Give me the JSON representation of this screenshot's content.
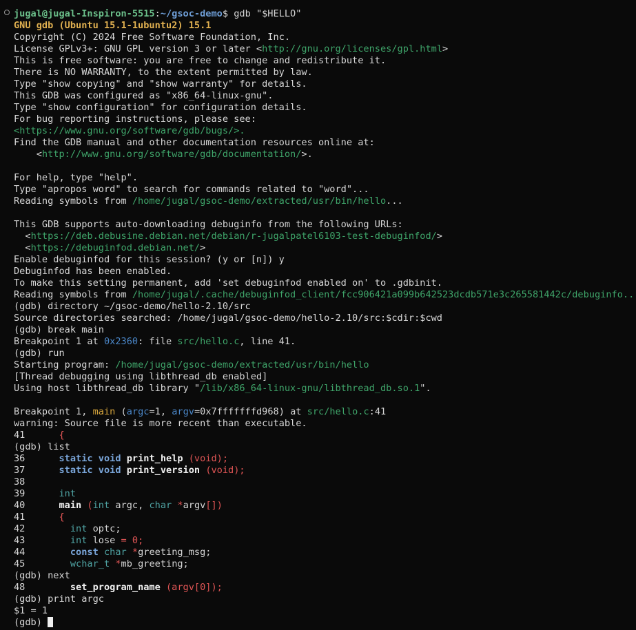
{
  "terminal": {
    "prompt_user": "jugal@jugal-Inspiron-5515",
    "prompt_sep": ":",
    "prompt_path": "~/gsoc-demo",
    "prompt_dollar": "$ ",
    "command": "gdb \"$HELLO\"",
    "gdb_version": "GNU gdb (Ubuntu 15.1-1ubuntu2) 15.1",
    "copyright": "Copyright (C) 2024 Free Software Foundation, Inc.",
    "license_pre": "License GPLv3+: GNU GPL version 3 or later <",
    "license_url": "http://gnu.org/licenses/gpl.html",
    "license_post": ">",
    "free_sw": "This is free software: you are free to change and redistribute it.",
    "no_warranty": "There is NO WARRANTY, to the extent permitted by law.",
    "show_copying": "Type \"show copying\" and \"show warranty\" for details.",
    "configured": "This GDB was configured as \"x86_64-linux-gnu\".",
    "show_config": "Type \"show configuration\" for configuration details.",
    "bug_report": "For bug reporting instructions, please see:",
    "bug_url_pre": "<",
    "bug_url": "https://www.gnu.org/software/gdb/bugs/",
    "bug_url_post": ">.",
    "find_manual": "Find the GDB manual and other documentation resources online at:",
    "doc_url_pre": "    <",
    "doc_url": "http://www.gnu.org/software/gdb/documentation/",
    "doc_url_post": ">.",
    "help": "For help, type \"help\".",
    "apropos": "Type \"apropos word\" to search for commands related to \"word\"...",
    "reading_symbols_pre": "Reading symbols from ",
    "reading_symbols_path": "/home/jugal/gsoc-demo/extracted/usr/bin/hello",
    "reading_symbols_post": "...",
    "debuginfo_supports": "This GDB supports auto-downloading debuginfo from the following URLs:",
    "dbg_url1_pre": "  <",
    "dbg_url1": "https://deb.debusine.debian.net/debian/r-jugalpatel6103-test-debuginfod/",
    "dbg_url1_post": ">",
    "dbg_url2_pre": "  <",
    "dbg_url2": "https://debuginfod.debian.net/",
    "dbg_url2_post": ">",
    "enable_q": "Enable debuginfod for this session? (y or [n]) y",
    "enabled": "Debuginfod has been enabled.",
    "permanent": "To make this setting permanent, add 'set debuginfod enabled on' to .gdbinit.",
    "reading2_pre": "Reading symbols from ",
    "reading2_path": "/home/jugal/.cache/debuginfod_client/fcc906421a099b642523dcdb571e3c265581442c/debuginfo...",
    "cmd_directory": "(gdb) directory ~/gsoc-demo/hello-2.10/src",
    "source_dirs": "Source directories searched: /home/jugal/gsoc-demo/hello-2.10/src:$cdir:$cwd",
    "cmd_break": "(gdb) break main",
    "bp_pre": "Breakpoint 1 at ",
    "bp_addr": "0x2360",
    "bp_mid": ": file ",
    "bp_file": "src/hello.c",
    "bp_post": ", line 41.",
    "cmd_run": "(gdb) run",
    "starting_pre": "Starting program: ",
    "starting_path": "/home/jugal/gsoc-demo/extracted/usr/bin/hello",
    "thread_dbg": "[Thread debugging using libthread_db enabled]",
    "host_lib_pre": "Using host libthread_db library \"",
    "host_lib_path": "/lib/x86_64-linux-gnu/libthread_db.so.1",
    "host_lib_post": "\".",
    "hit_pre": "Breakpoint 1, ",
    "hit_fn": "main",
    "hit_open": " (",
    "hit_argc": "argc",
    "hit_argc_val": "=1, ",
    "hit_argv": "argv",
    "hit_argv_val": "=0x7fffffffd968) at ",
    "hit_file": "src/hello.c",
    "hit_line": ":41",
    "warning": "warning: Source file is more recent than executable.",
    "l41a_num": "41",
    "l41a_code": "{",
    "cmd_list": "(gdb) list",
    "l36_num": "36",
    "l36_kw1": "static",
    "l36_kw2": "void",
    "l36_fn": "print_help",
    "l36_rest": "(void);",
    "l37_num": "37",
    "l37_kw1": "static",
    "l37_kw2": "void",
    "l37_fn": "print_version",
    "l37_rest": "(void);",
    "l38_num": "38",
    "l39_num": "39",
    "l39_type": "int",
    "l40_num": "40",
    "l40_fn": "main",
    "l40_p1": "(",
    "l40_t1": "int",
    "l40_a1": " argc, ",
    "l40_t2": "char",
    "l40_a2": " *",
    "l40_a3": "argv",
    "l40_p2": "[])",
    "l41_num": "41",
    "l41_code": "{",
    "l42_num": "42",
    "l42_type": "int",
    "l42_rest": " optc;",
    "l43_num": "43",
    "l43_type": "int",
    "l43_rest": " lose ",
    "l43_op": "= 0;",
    "l44_num": "44",
    "l44_kw": "const",
    "l44_type": "char",
    "l44_op": " *",
    "l44_rest": "greeting_msg;",
    "l45_num": "45",
    "l45_type": "wchar_t",
    "l45_op": " *",
    "l45_rest": "mb_greeting;",
    "cmd_next": "(gdb) next",
    "l48_num": "48",
    "l48_fn": "set_program_name",
    "l48_rest": " (argv",
    "l48_idx": "[0]",
    "l48_end": ");",
    "cmd_print": "(gdb) print argc",
    "print_result": "$1 = 1",
    "final_prompt": "(gdb) "
  },
  "colors": {
    "background": "#0a0a0a",
    "text": "#d7d7d7",
    "prompt_user": "#6bbf8a",
    "prompt_path": "#6f9fd8",
    "url": "#3fa56a",
    "header": "#e0b050"
  }
}
